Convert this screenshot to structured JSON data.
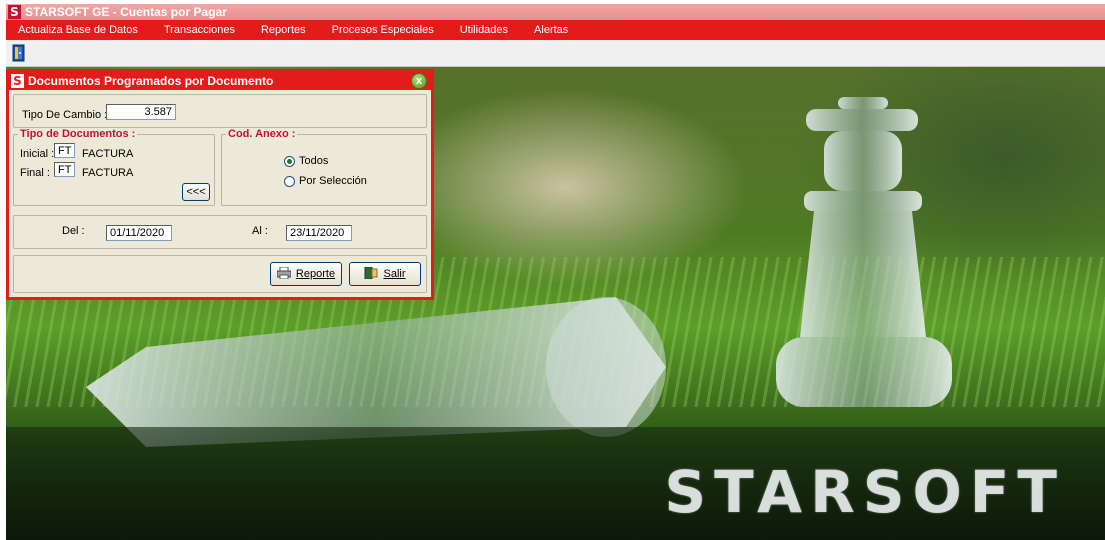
{
  "window": {
    "title": "STARSOFT GE  - Cuentas por Pagar",
    "logo_glyph": "S"
  },
  "menu": [
    {
      "label": "Actualiza Base de Datos"
    },
    {
      "label": "Transacciones"
    },
    {
      "label": "Reportes"
    },
    {
      "label": "Procesos Especiales"
    },
    {
      "label": "Utilidades"
    },
    {
      "label": "Alertas"
    }
  ],
  "toolbar": {
    "exit_icon": "door-exit-icon"
  },
  "dialog": {
    "title": "Documentos Programados por Documento",
    "close_glyph": "x",
    "tipo_cambio": {
      "label": "Tipo De Cambio :",
      "value": "3.587"
    },
    "tipo_documentos": {
      "legend": "Tipo de Documentos :",
      "inicial_label": "Inicial :",
      "inicial_code": "FT",
      "inicial_desc": "FACTURA",
      "final_label": "Final :",
      "final_code": "FT",
      "final_desc": "FACTURA",
      "copy_button": "<<<"
    },
    "cod_anexo": {
      "legend": "Cod. Anexo :",
      "options": [
        {
          "label": "Todos",
          "selected": true
        },
        {
          "label": "Por Selección",
          "selected": false
        }
      ]
    },
    "fechas": {
      "del_label": "Del :",
      "del_value": "01/11/2020",
      "al_label": "Al :",
      "al_value": "23/11/2020"
    },
    "buttons": {
      "reporte": "Reporte",
      "salir": "Salir"
    }
  },
  "background": {
    "watermark": "STARSOFT"
  },
  "colors": {
    "menu_red": "#e31b1b",
    "dialog_face": "#ece9d8",
    "legend_red": "#c8102e"
  }
}
